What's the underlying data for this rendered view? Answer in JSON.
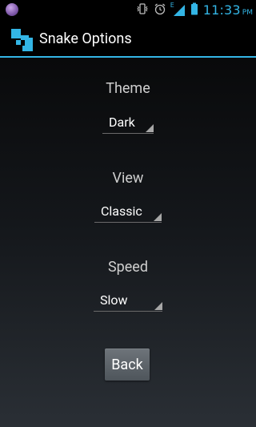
{
  "status_bar": {
    "time": "11:33",
    "ampm": "PM",
    "network_type": "E",
    "left_icon": "purple-orb-icon",
    "icons": [
      "vibrate-icon",
      "alarm-icon",
      "signal-icon",
      "battery-icon"
    ]
  },
  "action_bar": {
    "title": "Snake Options",
    "icon": "snake-app-icon"
  },
  "options": {
    "theme": {
      "label": "Theme",
      "value": "Dark"
    },
    "view": {
      "label": "View",
      "value": "Classic"
    },
    "speed": {
      "label": "Speed",
      "value": "Slow"
    }
  },
  "back_button": {
    "label": "Back"
  },
  "colors": {
    "accent": "#33b5e5",
    "background_top": "#050505",
    "background_bottom": "#2a2f35",
    "app_icon": "#33b5e5"
  }
}
